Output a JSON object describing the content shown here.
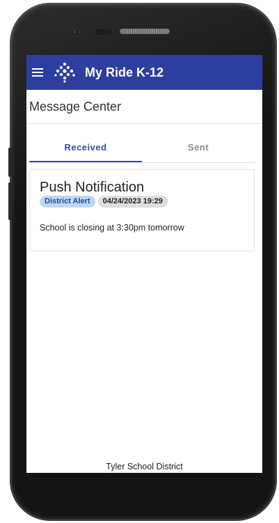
{
  "app_bar": {
    "title": "My Ride K-12",
    "menu_icon": "hamburger-menu-icon",
    "logo_icon": "diamond-dots-logo-icon",
    "color": "#2e3e9e"
  },
  "page": {
    "title": "Message Center"
  },
  "tabs": [
    {
      "label": "Received",
      "active": true
    },
    {
      "label": "Sent",
      "active": false
    }
  ],
  "messages": [
    {
      "title": "Push Notification",
      "category": "District Alert",
      "timestamp": "04/24/2023 19:29",
      "body": "School is closing at 3:30pm tomorrow"
    }
  ],
  "footer": {
    "text": "Tyler School District"
  },
  "colors": {
    "accent": "#3b4aa6",
    "chip_alert_bg": "#bcd8f6",
    "chip_date_bg": "#dedede"
  }
}
